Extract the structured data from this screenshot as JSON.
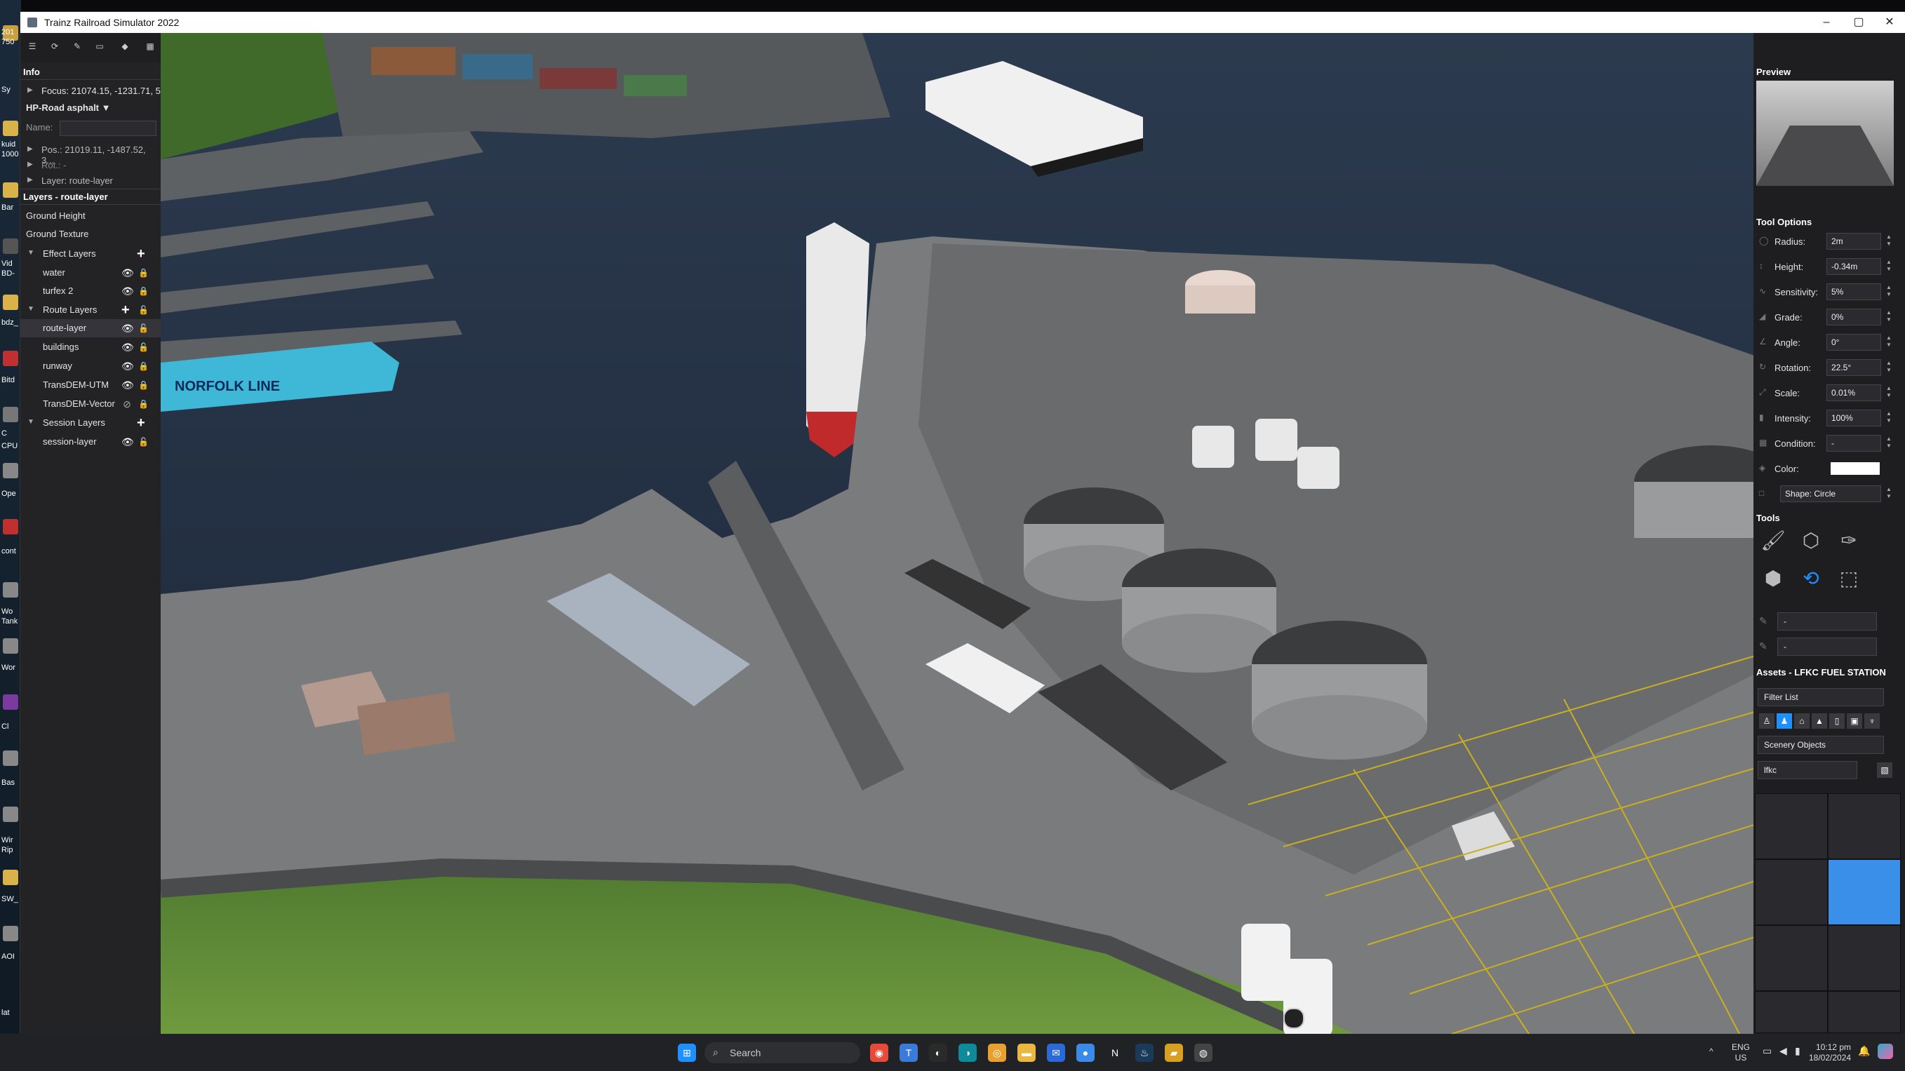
{
  "window": {
    "title": "Trainz Railroad Simulator 2022",
    "minimize": "–",
    "maximize": "▢",
    "close": "✕"
  },
  "desktop_labels": [
    "201",
    "750",
    "Sy",
    "kuid",
    "1000",
    "Bar",
    "Vid",
    "BD-",
    "bdz_",
    "Bitd",
    "C",
    "CPU",
    "Ope",
    "cont",
    "Wo",
    "Tank",
    "Wor",
    "Cl",
    "Bas",
    "Wir",
    "Rip",
    "SW_",
    "AOI",
    "lat"
  ],
  "info": {
    "header": "Info",
    "focus": "Focus: 21074.15, -1231.71, 5",
    "asset": "HP-Road asphalt ▼",
    "name_label": "Name:",
    "name_value": "",
    "pos": "Pos.: 21019.11, -1487.52, 3...",
    "rot": "Rot.: -",
    "layer": "Layer: route-layer"
  },
  "layers": {
    "header": "Layers - route-layer",
    "ground_height": "Ground Height",
    "ground_texture": "Ground Texture",
    "effect_group": "Effect Layers",
    "effect_items": [
      "water",
      "turfex 2"
    ],
    "route_group": "Route Layers",
    "route_items": [
      "route-layer",
      "buildings",
      "runway",
      "TransDEM-UTM",
      "TransDEM-Vector"
    ],
    "session_group": "Session Layers",
    "session_items": [
      "session-layer"
    ]
  },
  "viewport_labels": {
    "ship_name": "NORFOLK LINE"
  },
  "right": {
    "preview_header": "Preview",
    "tool_options_header": "Tool Options",
    "options": [
      {
        "label": "Radius:",
        "value": "2m"
      },
      {
        "label": "Height:",
        "value": "-0.34m"
      },
      {
        "label": "Sensitivity:",
        "value": "5%"
      },
      {
        "label": "Grade:",
        "value": "0%"
      },
      {
        "label": "Angle:",
        "value": "0°"
      },
      {
        "label": "Rotation:",
        "value": "22.5°"
      },
      {
        "label": "Scale:",
        "value": "0.01%"
      },
      {
        "label": "Intensity:",
        "value": "100%"
      },
      {
        "label": "Condition:",
        "value": "-"
      },
      {
        "label": "Color:",
        "value": ""
      }
    ],
    "shape": "Shape: Circle",
    "tools_header": "Tools",
    "tool_values": [
      "-",
      "-"
    ],
    "assets_header": "Assets - LFKC FUEL STATION",
    "filter_list": "Filter List",
    "category": "Scenery Objects",
    "search_value": "lfkc"
  },
  "taskbar": {
    "search_placeholder": "Search",
    "lang1": "ENG",
    "lang2": "US",
    "time": "10:12 pm",
    "date": "18/02/2024"
  },
  "colors": {
    "accent": "#1e90ff",
    "selected_asset": "#3a8fe8",
    "panel": "#232326"
  }
}
